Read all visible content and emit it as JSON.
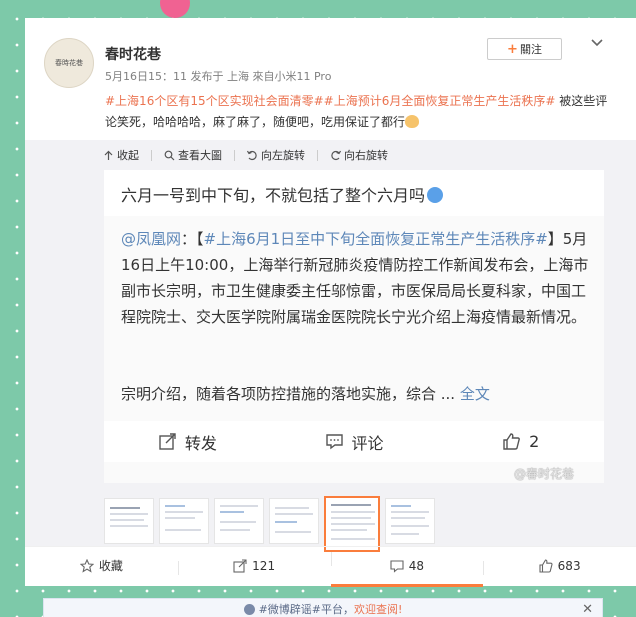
{
  "post": {
    "username": "春时花巷",
    "avatar_text": "春時花巷",
    "meta": "5月16日15：11 发布于 上海 來自小米11 Pro",
    "follow_label": "關注",
    "hashtag1": "#上海16个区有15个区实现社会面清零#",
    "hashtag2": "#上海预计6月全面恢复正常生产生活秩序#",
    "text": " 被这些评论笑死，哈哈哈哈，麻了麻了，随便吧，吃用保证了都行"
  },
  "media_toolbar": {
    "collapse": "收起",
    "view_large": "查看大圖",
    "rotate_left": "向左旋转",
    "rotate_right": "向右旋转"
  },
  "screenshot": {
    "heading": "六月一号到中下旬，不就包括了整个六月吗",
    "mention": "@凤凰网",
    "colon": "：【",
    "hashtag": "#上海6月1日至中下旬全面恢复正常生产生活秩序#",
    "body": "】5月16日上午10:00，上海举行新冠肺炎疫情防控工作新闻发布会，上海市副市长宗明，市卫生健康委主任邬惊雷，市医保局局长夏科家，中国工程院院士、交大医学院附属瑞金医院院长宁光介绍上海疫情最新情况。",
    "body2": "宗明介绍，随着各项防控措施的落地实施，综合 ... ",
    "full_text": "全文",
    "repost_label": "转发",
    "comment_label": "评论",
    "like_count": "2",
    "watermark": "@春时花巷"
  },
  "bottom_bar": {
    "favorite": "收藏",
    "repost_count": "121",
    "comment_count": "48",
    "like_count": "683"
  },
  "notice": {
    "text": "#微博辟谣#平台，",
    "link": "欢迎查阅!",
    "close": "✕"
  },
  "colors": {
    "background": "#7dc9a9",
    "tag": "#eb7350",
    "accent": "#fa7d3c",
    "link_blue": "#5d87b8"
  }
}
